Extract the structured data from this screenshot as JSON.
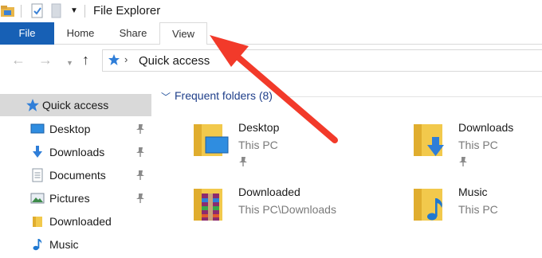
{
  "window": {
    "title": "File Explorer"
  },
  "ribbon": {
    "tabs": [
      {
        "label": "File"
      },
      {
        "label": "Home"
      },
      {
        "label": "Share"
      },
      {
        "label": "View"
      }
    ]
  },
  "address_bar": {
    "path": "Quick access"
  },
  "sidebar": {
    "items": [
      {
        "label": "Quick access",
        "icon": "star-icon",
        "pinned": false,
        "selected": true
      },
      {
        "label": "Desktop",
        "icon": "desktop-icon",
        "pinned": true
      },
      {
        "label": "Downloads",
        "icon": "download-icon",
        "pinned": true
      },
      {
        "label": "Documents",
        "icon": "documents-icon",
        "pinned": true
      },
      {
        "label": "Pictures",
        "icon": "pictures-icon",
        "pinned": true
      },
      {
        "label": "Downloaded",
        "icon": "folder-icon",
        "pinned": false
      },
      {
        "label": "Music",
        "icon": "music-icon",
        "pinned": false
      }
    ]
  },
  "content": {
    "group_title": "Frequent folders (8)",
    "folders": [
      {
        "name": "Desktop",
        "location": "This PC",
        "pinned": true,
        "icon": "desktop-folder-icon"
      },
      {
        "name": "Downloads",
        "location": "This PC",
        "pinned": true,
        "icon": "downloads-folder-icon"
      },
      {
        "name": "Downloaded",
        "location": "This PC\\Downloads",
        "pinned": false,
        "icon": "archive-folder-icon"
      },
      {
        "name": "Music",
        "location": "This PC",
        "pinned": false,
        "icon": "music-folder-icon"
      }
    ]
  },
  "colors": {
    "file_tab": "#1760b5",
    "annotation_arrow": "#f23a2a",
    "selected_row": "#d9d9d9",
    "group_heading": "#1f3f8a"
  }
}
